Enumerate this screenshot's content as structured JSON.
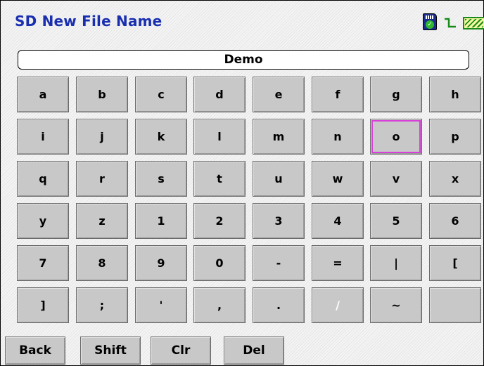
{
  "title": "SD New File Name",
  "status": {
    "icons": [
      "sd-card-icon",
      "signal-icon",
      "battery-icon"
    ],
    "battery_level": 1.0
  },
  "file_name": "Demo",
  "selected_key": "o",
  "keys": [
    "a",
    "b",
    "c",
    "d",
    "e",
    "f",
    "g",
    "h",
    "i",
    "j",
    "k",
    "l",
    "m",
    "n",
    "o",
    "p",
    "q",
    "r",
    "s",
    "t",
    "u",
    "w",
    "v",
    "x",
    "y",
    "z",
    "1",
    "2",
    "3",
    "4",
    "5",
    "6",
    "7",
    "8",
    "9",
    "0",
    "-",
    "=",
    "|",
    "[",
    "]",
    ";",
    "'",
    ",",
    ".",
    "/",
    "~",
    ""
  ],
  "buttons": {
    "back": "Back",
    "shift": "Shift",
    "clear": "Clr",
    "delete": "Del"
  },
  "colors": {
    "title": "#1a2fb0",
    "key": "#c8c8c8",
    "selection": "#d93fd9"
  }
}
